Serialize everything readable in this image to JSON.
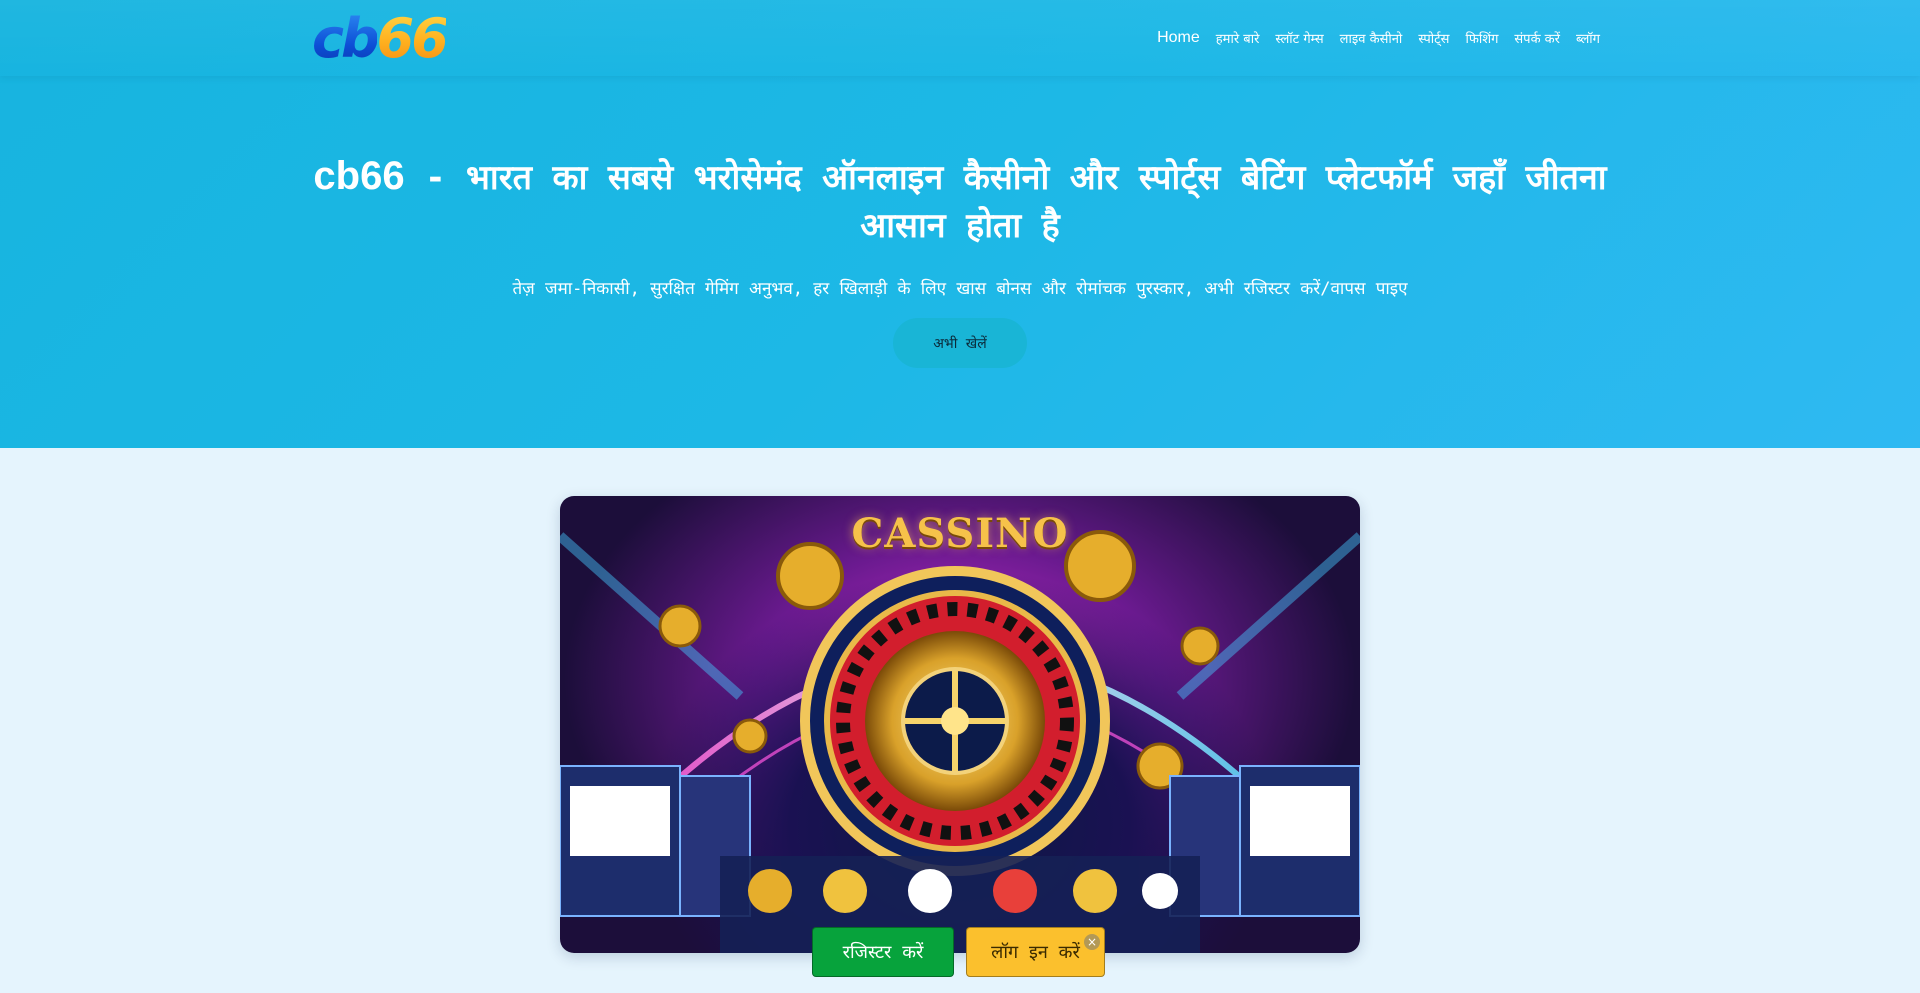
{
  "header": {
    "logo": {
      "part1": "cb",
      "part2": "66"
    },
    "nav": [
      "Home",
      "हमारे बारे",
      "स्लॉट गेम्स",
      "लाइव कैसीनो",
      "स्पोर्ट्स",
      "फिशिंग",
      "संपर्क करें",
      "ब्लॉग"
    ]
  },
  "hero": {
    "brand": "cb66",
    "headline": " - भारत का सबसे भरोसेमंद ऑनलाइन कैसीनो और स्पोर्ट्स बेटिंग प्लेटफॉर्म जहाँ जीतना आसान होता है",
    "subline": "तेज़ जमा-निकासी, सुरक्षित गेमिंग अनुभव, हर खिलाड़ी के लिए खास बोनस और रोमांचक पुरस्कार, अभी रजिस्टर करें/वापस पाइए",
    "cta_label": "अभी खेलें"
  },
  "banner": {
    "title": "CASSINO"
  },
  "floating_bar": {
    "register_label": "रजिस्टर करें",
    "login_label": "लॉग इन करें",
    "close_glyph": "×"
  },
  "colors": {
    "hero_bg": "#1db8e6",
    "page_bg": "#e5f4fd",
    "register_btn": "#07a33c",
    "login_btn": "#fbc02d"
  }
}
